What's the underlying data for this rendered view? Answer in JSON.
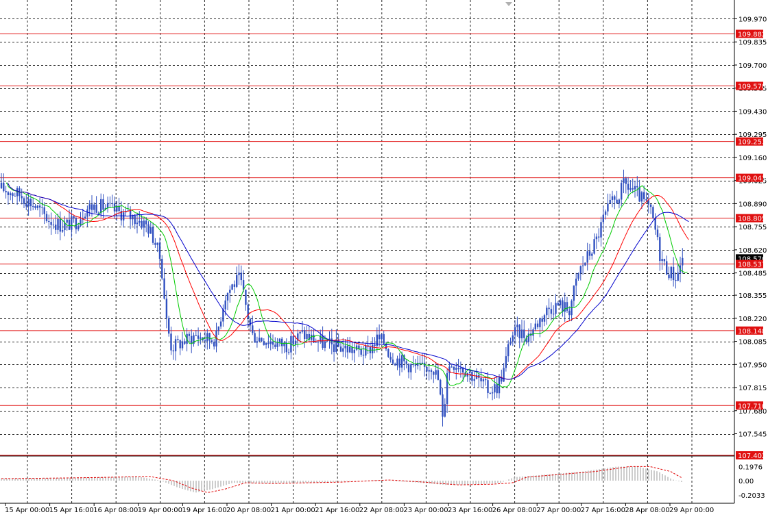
{
  "chart_data": {
    "type": "candlestick",
    "x_labels": [
      "15 Apr 00:00",
      "15 Apr 16:00",
      "16 Apr 08:00",
      "19 Apr 00:00",
      "19 Apr 16:00",
      "20 Apr 08:00",
      "21 Apr 00:00",
      "21 Apr 16:00",
      "22 Apr 08:00",
      "23 Apr 00:00",
      "23 Apr 16:00",
      "26 Apr 08:00",
      "27 Apr 00:00",
      "27 Apr 16:00",
      "28 Apr 08:00",
      "29 Apr 00:00"
    ],
    "price_ticks": [
      "109.970",
      "109.835",
      "109.700",
      "109.565",
      "109.430",
      "109.295",
      "109.160",
      "109.025",
      "108.890",
      "108.755",
      "108.620",
      "108.485",
      "108.355",
      "108.220",
      "108.085",
      "107.950",
      "107.815",
      "107.680",
      "107.545"
    ],
    "ylim": [
      107.415,
      110.08
    ],
    "current_price": "108.570",
    "levels": [
      {
        "label": "109.882",
        "value": 109.882
      },
      {
        "label": "109.578",
        "value": 109.578
      },
      {
        "label": "109.253",
        "value": 109.253
      },
      {
        "label": "109.041",
        "value": 109.041
      },
      {
        "label": "108.805",
        "value": 108.805
      },
      {
        "label": "108.537",
        "value": 108.537
      },
      {
        "label": "108.148",
        "value": 108.148
      },
      {
        "label": "107.710",
        "value": 107.71
      },
      {
        "label": "107.402",
        "value": 107.402
      }
    ],
    "price_path": [
      [
        0,
        108.98
      ],
      [
        30,
        108.94
      ],
      [
        50,
        108.88
      ],
      [
        70,
        108.8
      ],
      [
        90,
        108.76
      ],
      [
        110,
        108.78
      ],
      [
        125,
        108.86
      ],
      [
        140,
        108.88
      ],
      [
        160,
        108.86
      ],
      [
        180,
        108.83
      ],
      [
        200,
        108.8
      ],
      [
        215,
        108.76
      ],
      [
        225,
        108.68
      ],
      [
        235,
        108.55
      ],
      [
        243,
        108.2
      ],
      [
        250,
        108.05
      ],
      [
        265,
        108.08
      ],
      [
        285,
        108.12
      ],
      [
        300,
        108.1
      ],
      [
        315,
        108.1
      ],
      [
        328,
        108.35
      ],
      [
        340,
        108.42
      ],
      [
        350,
        108.45
      ],
      [
        358,
        108.3
      ],
      [
        368,
        108.12
      ],
      [
        385,
        108.1
      ],
      [
        400,
        108.08
      ],
      [
        420,
        108.06
      ],
      [
        440,
        108.13
      ],
      [
        455,
        108.1
      ],
      [
        480,
        108.06
      ],
      [
        500,
        108.05
      ],
      [
        520,
        108.03
      ],
      [
        535,
        108.02
      ],
      [
        550,
        108.1
      ],
      [
        560,
        108.08
      ],
      [
        570,
        108.0
      ],
      [
        585,
        107.97
      ],
      [
        600,
        107.94
      ],
      [
        615,
        107.92
      ],
      [
        630,
        107.95
      ],
      [
        640,
        107.85
      ],
      [
        646,
        107.6
      ],
      [
        652,
        107.92
      ],
      [
        660,
        107.96
      ],
      [
        670,
        107.95
      ],
      [
        685,
        107.9
      ],
      [
        700,
        107.85
      ],
      [
        712,
        107.8
      ],
      [
        725,
        107.82
      ],
      [
        735,
        107.92
      ],
      [
        745,
        108.12
      ],
      [
        755,
        108.14
      ],
      [
        770,
        108.12
      ],
      [
        785,
        108.2
      ],
      [
        800,
        108.28
      ],
      [
        815,
        108.3
      ],
      [
        830,
        108.27
      ],
      [
        845,
        108.5
      ],
      [
        860,
        108.6
      ],
      [
        870,
        108.68
      ],
      [
        880,
        108.8
      ],
      [
        890,
        108.88
      ],
      [
        900,
        108.92
      ],
      [
        910,
        109.0
      ],
      [
        920,
        108.98
      ],
      [
        935,
        108.92
      ],
      [
        948,
        108.85
      ],
      [
        955,
        108.75
      ],
      [
        962,
        108.6
      ],
      [
        970,
        108.52
      ],
      [
        980,
        108.48
      ],
      [
        987,
        108.46
      ],
      [
        995,
        108.58
      ],
      [
        1000,
        108.58
      ]
    ],
    "ma_periods": [
      8,
      21,
      34
    ],
    "ma_colors": {
      "fast": "#00cc00",
      "mid": "#ff0000",
      "slow": "#0000cc"
    },
    "oscillator": {
      "ticks": [
        "0.1976",
        "0.00",
        "-0.2033"
      ],
      "ylim": [
        -0.32,
        0.34
      ],
      "profile": [
        [
          0,
          0.03
        ],
        [
          90,
          0.04
        ],
        [
          150,
          0.05
        ],
        [
          200,
          0.06
        ],
        [
          235,
          0.0
        ],
        [
          260,
          -0.1
        ],
        [
          285,
          -0.17
        ],
        [
          310,
          -0.12
        ],
        [
          340,
          -0.03
        ],
        [
          380,
          -0.04
        ],
        [
          430,
          -0.03
        ],
        [
          480,
          -0.02
        ],
        [
          550,
          0.01
        ],
        [
          600,
          -0.02
        ],
        [
          650,
          -0.06
        ],
        [
          700,
          -0.05
        ],
        [
          730,
          -0.03
        ],
        [
          750,
          0.05
        ],
        [
          800,
          0.09
        ],
        [
          850,
          0.13
        ],
        [
          900,
          0.2
        ],
        [
          930,
          0.2
        ],
        [
          960,
          0.13
        ],
        [
          980,
          0.02
        ],
        [
          998,
          -0.03
        ]
      ]
    },
    "colors": {
      "candle": "#3050c0",
      "grid": "#000000",
      "level": "#e01010",
      "level_label_bg": "#e01010",
      "current_label_bg": "#000000",
      "osc_bar": "#c0c0c0",
      "osc_signal": "#e00000"
    }
  }
}
